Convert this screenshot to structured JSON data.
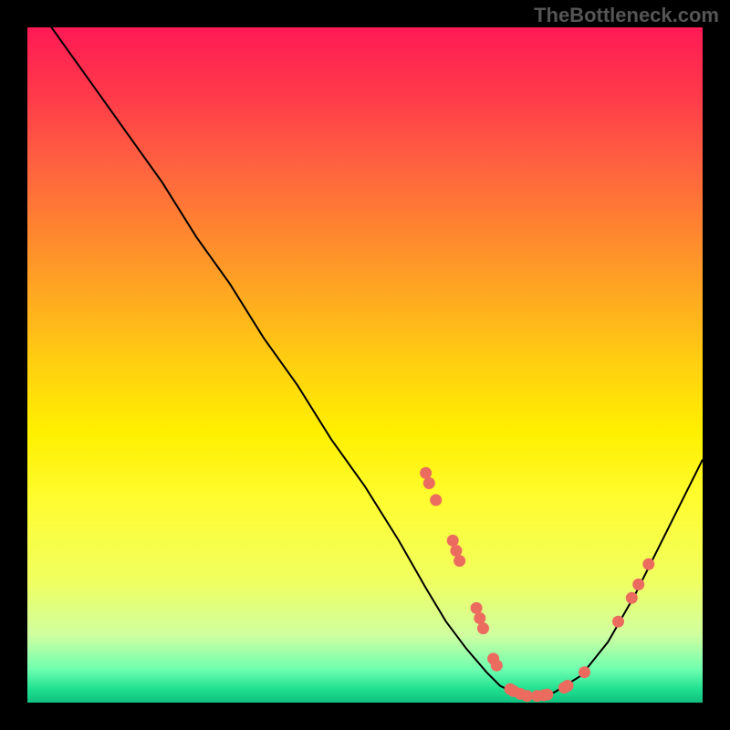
{
  "watermark": "TheBottleneck.com",
  "chart_data": {
    "type": "line",
    "title": "",
    "xlabel": "",
    "ylabel": "",
    "xlim": [
      0,
      100
    ],
    "ylim": [
      0,
      100
    ],
    "series": [
      {
        "name": "curve",
        "x": [
          0,
          5,
          10,
          15,
          20,
          25,
          30,
          35,
          40,
          45,
          50,
          55,
          59,
          62,
          65,
          68,
          70,
          72,
          75,
          78,
          82,
          86,
          90,
          94,
          98,
          100
        ],
        "y": [
          105,
          98,
          91,
          84,
          77,
          69,
          62,
          54,
          47,
          39,
          32,
          24,
          17,
          12,
          8,
          4.5,
          2.5,
          1.5,
          1.0,
          1.5,
          4,
          9,
          16,
          24,
          32,
          36
        ]
      }
    ],
    "markers": [
      {
        "x": 59.0,
        "y": 34.0
      },
      {
        "x": 59.5,
        "y": 32.5
      },
      {
        "x": 60.5,
        "y": 30.0
      },
      {
        "x": 63.0,
        "y": 24.0
      },
      {
        "x": 63.5,
        "y": 22.5
      },
      {
        "x": 64.0,
        "y": 21.0
      },
      {
        "x": 66.5,
        "y": 14.0
      },
      {
        "x": 67.0,
        "y": 12.5
      },
      {
        "x": 67.5,
        "y": 11.0
      },
      {
        "x": 69.0,
        "y": 6.5
      },
      {
        "x": 69.5,
        "y": 5.5
      },
      {
        "x": 71.5,
        "y": 2.0
      },
      {
        "x": 72.0,
        "y": 1.7
      },
      {
        "x": 73.0,
        "y": 1.3
      },
      {
        "x": 74.0,
        "y": 1.0
      },
      {
        "x": 75.5,
        "y": 1.0
      },
      {
        "x": 76.5,
        "y": 1.1
      },
      {
        "x": 77.0,
        "y": 1.2
      },
      {
        "x": 79.5,
        "y": 2.2
      },
      {
        "x": 80.0,
        "y": 2.5
      },
      {
        "x": 82.5,
        "y": 4.5
      },
      {
        "x": 87.5,
        "y": 12.0
      },
      {
        "x": 89.5,
        "y": 15.5
      },
      {
        "x": 90.5,
        "y": 17.5
      },
      {
        "x": 92.0,
        "y": 20.5
      }
    ],
    "marker_color": "#ec6b5f",
    "line_color": "#000000",
    "gradient_stops": [
      {
        "pos": 0,
        "color": "#ff1a55"
      },
      {
        "pos": 50,
        "color": "#fff000"
      },
      {
        "pos": 95,
        "color": "#70ffb0"
      },
      {
        "pos": 100,
        "color": "#10c080"
      }
    ]
  }
}
